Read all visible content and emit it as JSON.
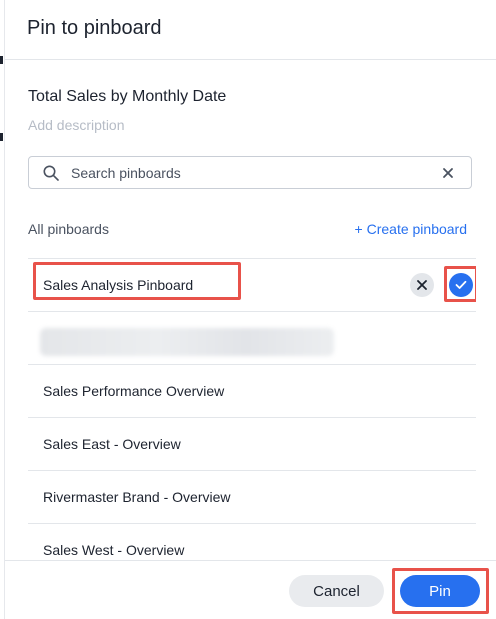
{
  "dialog": {
    "title": "Pin to pinboard",
    "answer_title": "Total Sales by Monthly Date",
    "description_placeholder": "Add description"
  },
  "search": {
    "placeholder": "Search pinboards",
    "value": ""
  },
  "list": {
    "header_label": "All pinboards",
    "create_label": "+ Create pinboard",
    "items": [
      {
        "label": "Sales Analysis Pinboard",
        "selected": true,
        "highlighted": true
      },
      {
        "label": "",
        "blurred": true
      },
      {
        "label": "Sales Performance Overview"
      },
      {
        "label": "Sales East - Overview"
      },
      {
        "label": "Rivermaster Brand - Overview"
      },
      {
        "label": "Sales West - Overview"
      }
    ]
  },
  "footer": {
    "cancel_label": "Cancel",
    "pin_label": "Pin"
  },
  "colors": {
    "accent": "#2770ef",
    "annotation": "#e8524a",
    "text": "#1d232f",
    "muted": "#b6bcc6"
  }
}
